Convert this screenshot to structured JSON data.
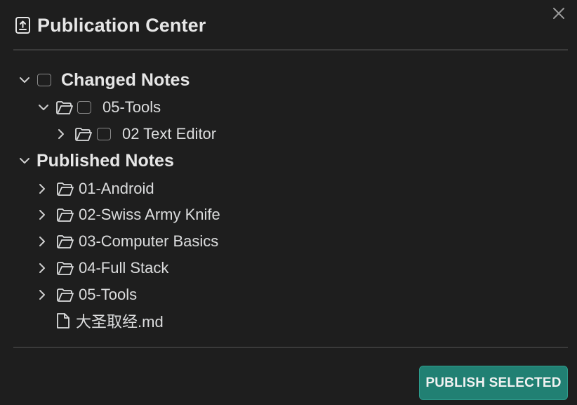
{
  "dialog": {
    "title": "Publication Center",
    "header_icon": "upload-file-icon",
    "close_icon": "close-icon"
  },
  "tree": {
    "changed": {
      "label": "Changed Notes",
      "expanded": true,
      "checked": false,
      "children": [
        {
          "label": "05-Tools",
          "expanded": true,
          "checked": false,
          "children": [
            {
              "label": "02 Text Editor",
              "expanded": false,
              "checked": false
            }
          ]
        }
      ]
    },
    "published": {
      "label": "Published Notes",
      "expanded": true,
      "items": [
        {
          "label": "01-Android",
          "type": "folder",
          "expanded": false
        },
        {
          "label": "02-Swiss Army Knife",
          "type": "folder",
          "expanded": false
        },
        {
          "label": "03-Computer Basics",
          "type": "folder",
          "expanded": false
        },
        {
          "label": "04-Full Stack",
          "type": "folder",
          "expanded": false
        },
        {
          "label": "05-Tools",
          "type": "folder",
          "expanded": false
        },
        {
          "label": "大圣取经.md",
          "type": "file"
        }
      ]
    }
  },
  "footer": {
    "publish_label": "PUBLISH SELECTED",
    "publish_color": "#218073"
  },
  "colors": {
    "background": "#1e1e1e",
    "text": "#dcddde",
    "divider": "#3a3a3a",
    "accent": "#218073"
  }
}
